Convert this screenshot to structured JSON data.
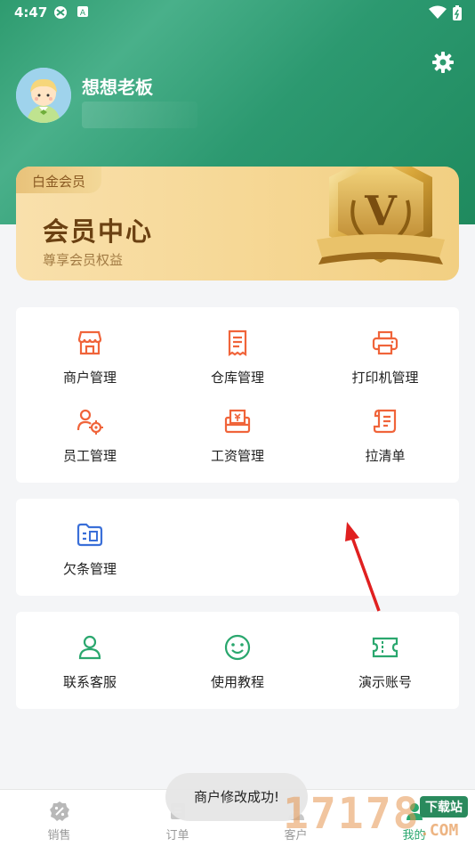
{
  "status_bar": {
    "time": "4:47"
  },
  "profile": {
    "username": "想想老板"
  },
  "vip_card": {
    "tag": "白金会员",
    "title": "会员中心",
    "subtitle": "尊享会员权益",
    "badge_letter": "V"
  },
  "panel_main": {
    "items": [
      {
        "label": "商户管理",
        "icon": "store-icon"
      },
      {
        "label": "仓库管理",
        "icon": "receipt-icon"
      },
      {
        "label": "打印机管理",
        "icon": "printer-icon"
      },
      {
        "label": "员工管理",
        "icon": "staff-settings-icon"
      },
      {
        "label": "工资管理",
        "icon": "salary-icon"
      },
      {
        "label": "拉清单",
        "icon": "list-scroll-icon"
      }
    ]
  },
  "panel_debt": {
    "items": [
      {
        "label": "欠条管理",
        "icon": "folder-id-icon"
      }
    ]
  },
  "panel_support": {
    "items": [
      {
        "label": "联系客服",
        "icon": "person-icon"
      },
      {
        "label": "使用教程",
        "icon": "smile-icon"
      },
      {
        "label": "演示账号",
        "icon": "ticket-icon"
      }
    ]
  },
  "tabbar": {
    "tabs": [
      {
        "label": "销售",
        "icon": "percent-badge-icon"
      },
      {
        "label": "订单",
        "icon": "order-icon"
      },
      {
        "label": "客户",
        "icon": "customer-icon"
      },
      {
        "label": "我的",
        "icon": "mine-icon"
      }
    ]
  },
  "toast": {
    "message": "商户修改成功!"
  },
  "watermark": {
    "digits": "17178",
    "chip": "下载站",
    "suffix": ".COM"
  },
  "colors": {
    "header_green": "#2e9b6f",
    "icon_orange": "#f0643a",
    "icon_blue": "#3a6fd8",
    "icon_green": "#2aa76e",
    "vip_gold": "#f6d896",
    "arrow_red": "#e02020"
  }
}
